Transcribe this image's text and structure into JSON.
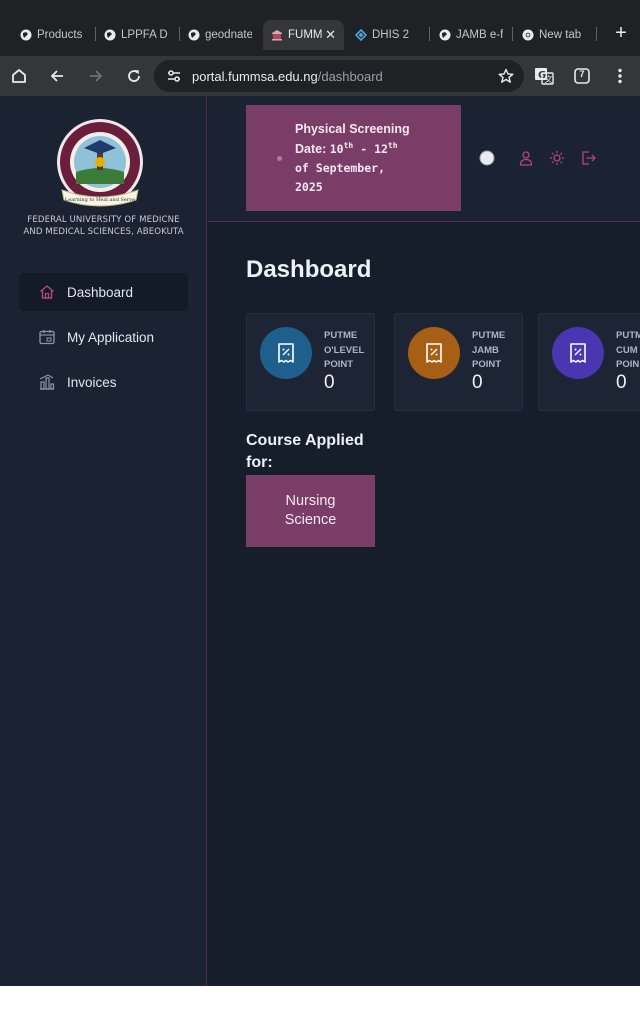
{
  "browser": {
    "tabs": [
      {
        "label": "Products",
        "fade": "",
        "active": false
      },
      {
        "label": "LPPFA D",
        "fade": "",
        "active": false
      },
      {
        "label": "geodnate",
        "fade": "",
        "active": false
      },
      {
        "label": "FUMM",
        "fade": "",
        "active": true
      },
      {
        "label": "DHIS 2",
        "fade": "",
        "active": false
      },
      {
        "label": "JAMB e-f",
        "fade": "",
        "active": false
      },
      {
        "label": "New tab",
        "fade": "",
        "active": false
      }
    ],
    "url_host": "portal.fummsa.edu.ng",
    "url_path": "/dashboard",
    "tab_count": "7"
  },
  "sidebar": {
    "university_name_line1": "FEDERAL UNIVERSITY OF MEDICNE",
    "university_name_line2": "AND MEDICAL SCIENCES, ABEOKUTA",
    "logo_motto": "Learning to Heal and Serve",
    "items": [
      {
        "label": "Dashboard",
        "icon": "home-icon",
        "active": true
      },
      {
        "label": "My Application",
        "icon": "calendar-icon",
        "active": false
      },
      {
        "label": "Invoices",
        "icon": "chart-icon",
        "active": false
      }
    ]
  },
  "banner": {
    "line1": "Physical Screening",
    "date_label": "Date:",
    "date_from": "10",
    "date_from_suffix": "th",
    "date_sep": "-",
    "date_to": "12",
    "date_to_suffix": "th",
    "line3": "of September,",
    "line4": "2025"
  },
  "main": {
    "title": "Dashboard",
    "cards": [
      {
        "label_lines": [
          "PUTME",
          "O'LEVEL",
          "POINT"
        ],
        "value": "0",
        "color": "#1f5f8b"
      },
      {
        "label_lines": [
          "PUTME",
          "JAMB",
          "POINT"
        ],
        "value": "0",
        "color": "#a65f14"
      },
      {
        "label_lines": [
          "PUTM",
          "CUM",
          "POIN"
        ],
        "value": "0",
        "color": "#4a36b0"
      }
    ],
    "course_label": "Course Applied for:",
    "course_value": "Nursing Science"
  },
  "colors": {
    "accent": "#7a3d68",
    "sidebar_bg": "#1b2231",
    "page_bg": "#161d2b"
  }
}
